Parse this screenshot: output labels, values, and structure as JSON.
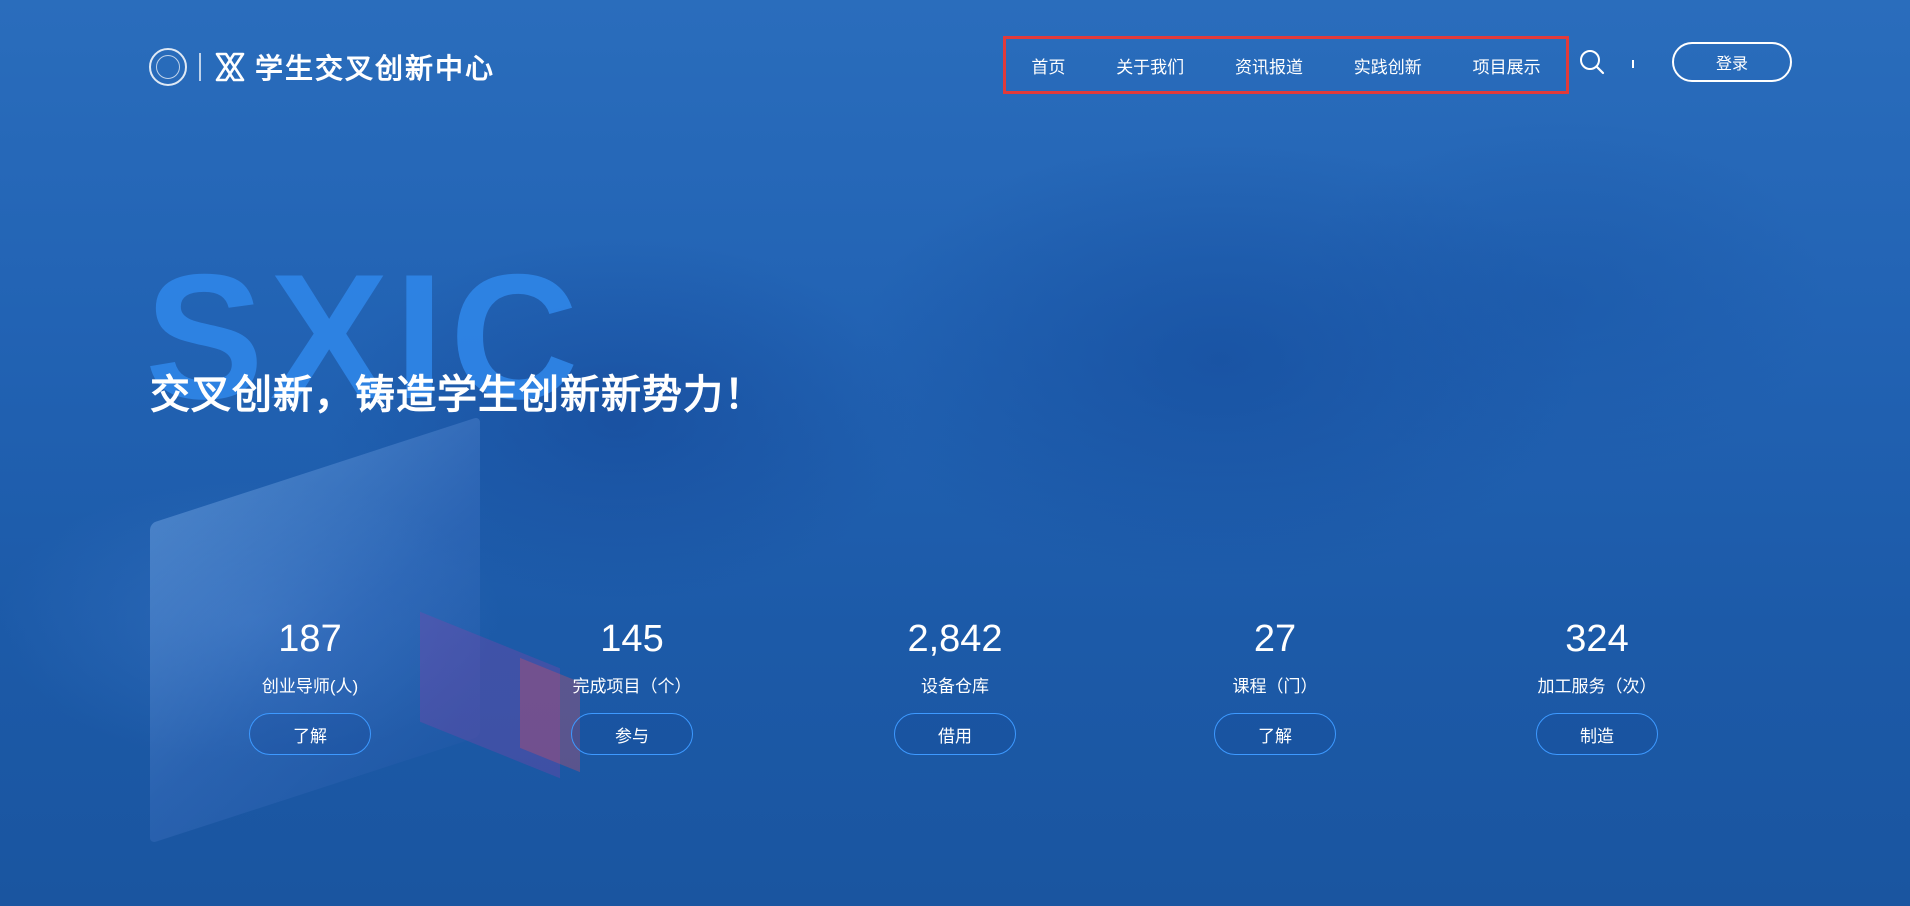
{
  "header": {
    "logo_text": "学生交叉创新中心",
    "nav": [
      "首页",
      "关于我们",
      "资讯报道",
      "实践创新",
      "项目展示"
    ],
    "login_label": "登录",
    "search_icon": "search-icon",
    "nav_highlight_color": "#e23a3a"
  },
  "hero": {
    "big_text": "SXIC",
    "slogan": "交叉创新，铸造学生创新新势力！"
  },
  "stats": [
    {
      "value": "187",
      "label": "创业导师(人)",
      "button": "了解"
    },
    {
      "value": "145",
      "label": "完成项目（个）",
      "button": "参与"
    },
    {
      "value": "2,842",
      "label": "设备仓库",
      "button": "借用"
    },
    {
      "value": "27",
      "label": "课程（门）",
      "button": "了解"
    },
    {
      "value": "324",
      "label": "加工服务（次）",
      "button": "制造"
    }
  ],
  "colors": {
    "accent": "#2f86e8",
    "button_border": "#3d99ff",
    "background": "#2263b4"
  }
}
